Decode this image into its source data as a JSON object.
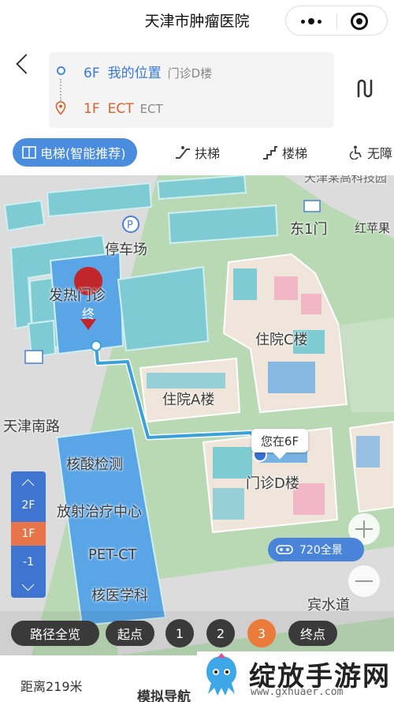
{
  "header": {
    "title": "天津市肿瘤医院"
  },
  "route": {
    "origin": {
      "floor": "6F",
      "name": "我的位置",
      "building": "门诊D楼"
    },
    "destination": {
      "floor": "1F",
      "name": "ECT",
      "building": "ECT"
    }
  },
  "tabs": [
    {
      "label": "电梯(智能推荐)",
      "icon": "elevator-icon",
      "active": true
    },
    {
      "label": "扶梯",
      "icon": "escalator-icon",
      "active": false
    },
    {
      "label": "楼梯",
      "icon": "stairs-icon",
      "active": false
    },
    {
      "label": "无障",
      "icon": "accessible-icon",
      "active": false
    }
  ],
  "map": {
    "labels": {
      "parking": "停车场",
      "fever_clinic": "发热门诊",
      "east_gate": "东1门",
      "inpatient_c": "住院C楼",
      "inpatient_a": "住院A楼",
      "tianjin_south_road": "天津南路",
      "nucleic_acid": "核酸检测",
      "radiotherapy": "放射治疗中心",
      "pet_ct": "PET-CT",
      "nuclear_medicine": "核医学科",
      "outpatient_d": "门诊D楼",
      "binshui_road": "宾水道",
      "hongpingguo": "红苹果",
      "top_partial": "天津某高科技园"
    },
    "end_marker": "终",
    "you_are_here": "您在6F",
    "panorama": "720全景",
    "floors": [
      "2F",
      "1F",
      "-1"
    ],
    "active_floor": "1F"
  },
  "steps": {
    "overview": "路径全览",
    "start": "起点",
    "numbers": [
      "1",
      "2",
      "3"
    ],
    "active": "3",
    "end": "终点"
  },
  "footer": {
    "distance": "距离219米",
    "simulate": "模拟导航"
  },
  "watermark": {
    "title": "绽放手游网",
    "url": "www.gxhuaer.com"
  }
}
